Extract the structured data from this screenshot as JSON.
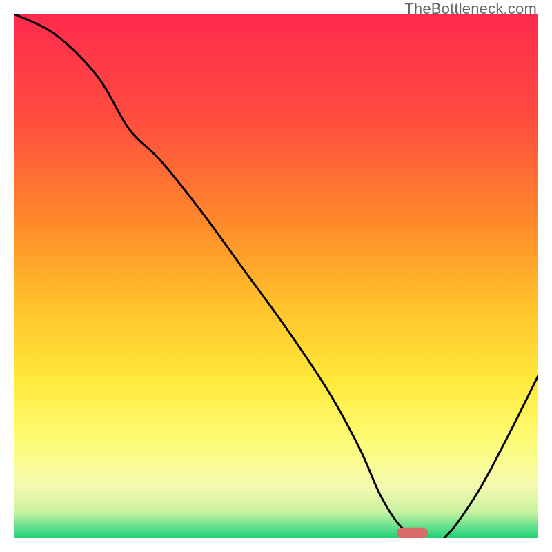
{
  "watermark": "TheBottleneck.com",
  "chart_data": {
    "type": "line",
    "title": "",
    "xlabel": "",
    "ylabel": "",
    "xlim": [
      0,
      100
    ],
    "ylim": [
      0,
      100
    ],
    "note": "Bottleneck % curve over a red→yellow→green vertical gradient. Y is bottleneck percentage (0 = ideal, at bottom). X is a normalized hardware selection axis. Curve shows a single dip near x≈75 reaching ~0%.",
    "series": [
      {
        "name": "bottleneck-curve",
        "x": [
          0,
          8,
          16,
          22,
          28,
          36,
          44,
          52,
          60,
          66,
          70,
          74,
          78,
          82,
          88,
          94,
          100
        ],
        "y": [
          100,
          96,
          88,
          78,
          72,
          62,
          51,
          40,
          28,
          17,
          8,
          2,
          0,
          0,
          8,
          19,
          31
        ]
      }
    ],
    "marker": {
      "name": "optimal-point",
      "x": 76,
      "y": 1,
      "width": 6,
      "height": 2,
      "color": "#d96a6a"
    },
    "gradient_stops": [
      {
        "offset": 0,
        "color": "#ff2a4d"
      },
      {
        "offset": 20,
        "color": "#ff4d3f"
      },
      {
        "offset": 40,
        "color": "#ff8a2a"
      },
      {
        "offset": 55,
        "color": "#ffc02a"
      },
      {
        "offset": 70,
        "color": "#ffe93a"
      },
      {
        "offset": 82,
        "color": "#fdfd7a"
      },
      {
        "offset": 90,
        "color": "#f4f9b0"
      },
      {
        "offset": 95,
        "color": "#c9f2a0"
      },
      {
        "offset": 98,
        "color": "#5fe08c"
      },
      {
        "offset": 100,
        "color": "#1fcf74"
      }
    ]
  }
}
